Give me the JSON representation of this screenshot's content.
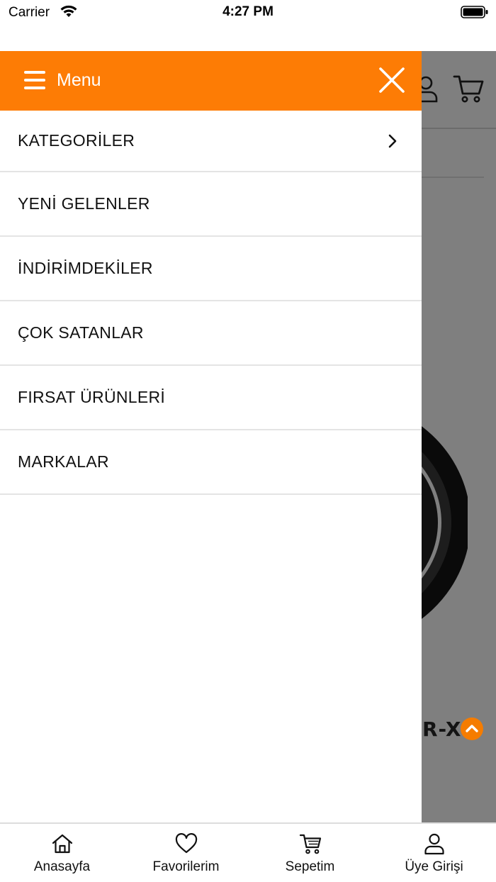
{
  "status_bar": {
    "carrier": "Carrier",
    "time": "4:27 PM"
  },
  "drawer": {
    "title": "Menu",
    "accent_color": "#fd7c05",
    "items": [
      {
        "label": "KATEGORİLER",
        "has_submenu": true
      },
      {
        "label": "YENİ GELENLER"
      },
      {
        "label": "İNDİRİMDEKİLER"
      },
      {
        "label": "ÇOK SATANLAR"
      },
      {
        "label": "FIRSAT ÜRÜNLERİ"
      },
      {
        "label": "MARKALAR"
      }
    ]
  },
  "background": {
    "brand_text": "R-X"
  },
  "tab_bar": {
    "tabs": [
      {
        "label": "Anasayfa",
        "icon": "home-icon"
      },
      {
        "label": "Favorilerim",
        "icon": "heart-icon"
      },
      {
        "label": "Sepetim",
        "icon": "cart-icon"
      },
      {
        "label": "Üye Girişi",
        "icon": "user-icon"
      }
    ]
  }
}
